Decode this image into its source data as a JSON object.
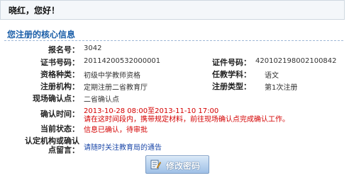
{
  "greeting": "晓红，您好！",
  "section_title": "您注册的核心信息",
  "fields": {
    "report_no": {
      "label": "报名号：",
      "value": "3042"
    },
    "cert_no": {
      "label": "证书号码：",
      "value": "20114200532000001"
    },
    "id_no": {
      "label": "证件号码：",
      "value": "420102198002100842"
    },
    "qual_type": {
      "label": "资格种类：",
      "value": "初级中学教师资格"
    },
    "subject": {
      "label": "任教学科：",
      "value": "语文"
    },
    "reg_org": {
      "label": "注册机构：",
      "value": "定期注册二省教育厅"
    },
    "reg_type": {
      "label": "注册类型：",
      "value": "第1次注册"
    },
    "site": {
      "label": "现场确认点：",
      "value": "二省确认点"
    },
    "confirm_time": {
      "label": "确认时间：",
      "value": "2013-10-28 08:00至2013-11-10 17:00",
      "note": "请在这时间段内，携带规定材料，前往现场确认点完成确认工作。"
    },
    "status": {
      "label": "当前状态：",
      "value": "信息已确认，待审批"
    },
    "message": {
      "label_line1": "认定机构或确认",
      "label_line2": "点留言：",
      "value": "请随时关注教育局的通告"
    }
  },
  "button": {
    "label": "修改密码",
    "icon": "edit-password-icon"
  }
}
